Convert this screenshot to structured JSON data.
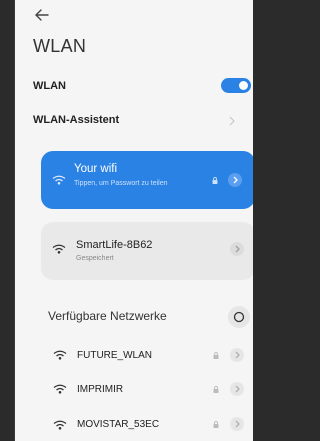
{
  "header": {
    "back_icon": "arrow-left-icon",
    "title": "WLAN"
  },
  "settings": {
    "wlan_label": "WLAN",
    "wlan_enabled": true,
    "assistant_label": "WLAN-Assistent"
  },
  "connected": {
    "name": "Your wifi",
    "subtitle": "Tippen, um Passwort zu teilen"
  },
  "saved": {
    "name": "SmartLife-8B62",
    "status": "Gespeichert"
  },
  "available": {
    "title": "Verfügbare Netzwerke",
    "networks": [
      {
        "name": "FUTURE_WLAN"
      },
      {
        "name": "IMPRIMIR"
      },
      {
        "name": "MOVISTAR_53EC"
      }
    ]
  },
  "colors": {
    "accent": "#2a82e4",
    "background": "#f5f5f5"
  }
}
